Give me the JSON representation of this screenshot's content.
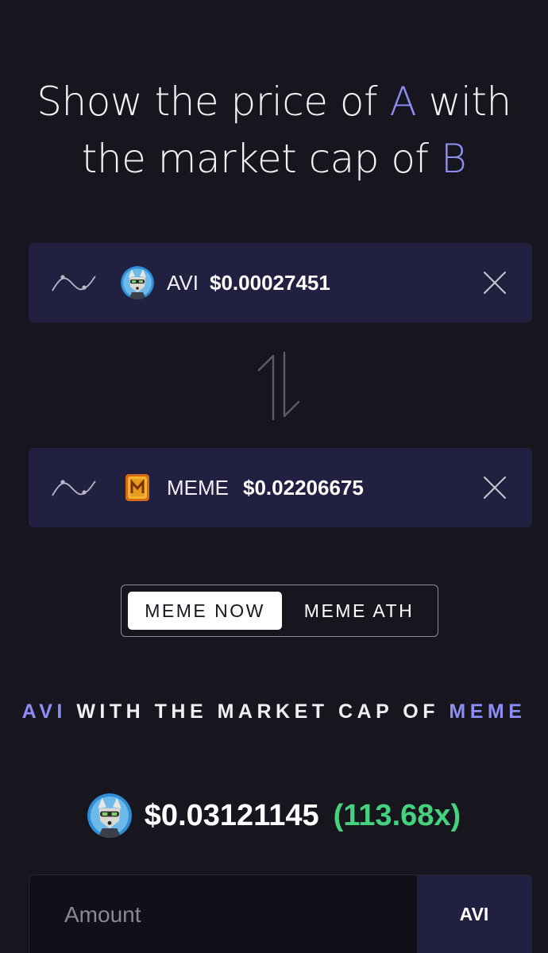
{
  "headline": {
    "part1": "Show the price of ",
    "a": "A",
    "part2": " with the market cap of ",
    "b": "B"
  },
  "token_a": {
    "symbol": "AVI",
    "price": "$0.00027451",
    "logo_icon": "avi-fox-logo-icon",
    "chart_icon": "price-chart-icon",
    "close_icon": "close-icon"
  },
  "token_b": {
    "symbol": "MEME",
    "price": "$0.02206675",
    "logo_icon": "meme-coin-logo-icon",
    "chart_icon": "price-chart-icon",
    "close_icon": "close-icon"
  },
  "swap_icon": "swap-arrows-icon",
  "toggle": {
    "options": [
      "MEME NOW",
      "MEME ATH"
    ],
    "selected": "MEME NOW"
  },
  "result": {
    "label_token_a": "AVI",
    "label_middle": " WITH THE MARKET CAP OF ",
    "label_token_b": "MEME",
    "price": "$0.03121145",
    "multiplier": "(113.68x)"
  },
  "amount": {
    "placeholder": "Amount",
    "value": "",
    "unit": "AVI"
  },
  "colors": {
    "background": "#17161e",
    "card": "#222040",
    "accent": "#8d8ef5",
    "positive": "#44d27f"
  }
}
